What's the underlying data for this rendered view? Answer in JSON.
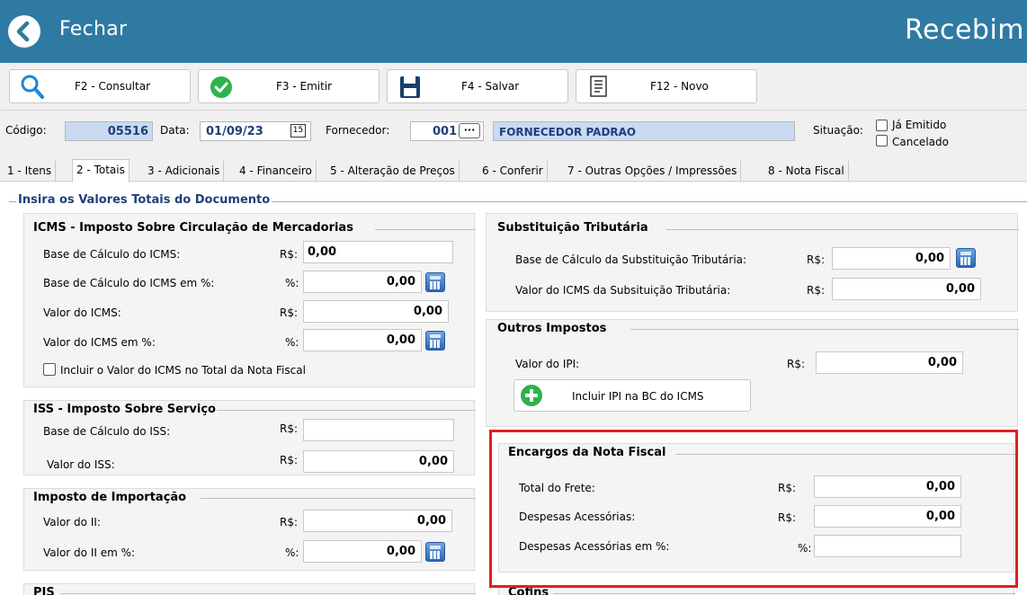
{
  "topbar": {
    "close_label": "Fechar",
    "title": "Recebim"
  },
  "toolbar": {
    "consultar": "F2 - Consultar",
    "emitir": "F3 - Emitir",
    "salvar": "F4 - Salvar",
    "novo": "F12 - Novo"
  },
  "header": {
    "codigo_label": "Código:",
    "codigo_value": "05516",
    "data_label": "Data:",
    "data_value": "01/09/23",
    "calendar_glyph": "15",
    "fornecedor_label": "Fornecedor:",
    "fornecedor_code": "001",
    "fornecedor_lookup": "···",
    "fornecedor_name": "FORNECEDOR PADRAO",
    "situacao_label": "Situação:",
    "ja_emitido": "Já Emitido",
    "cancelado": "Cancelado"
  },
  "tabs": [
    "1 - Itens",
    "2 - Totais",
    "3 - Adicionais",
    "4 - Financeiro",
    "5 - Alteração de Preços",
    "6 - Conferir",
    "7 - Outras Opções / Impressões",
    "8 - Nota Fiscal"
  ],
  "main_legend": "Insira os Valores Totais do Documento",
  "icms": {
    "title": "ICMS - Imposto Sobre Circulação de Mercadorias",
    "rows": [
      {
        "label": "Base de Cálculo do ICMS:",
        "unit": "R$:",
        "value": "0,00"
      },
      {
        "label": "Base de Cálculo do ICMS em %:",
        "unit": "%:",
        "value": "0,00"
      },
      {
        "label": "Valor do ICMS:",
        "unit": "R$:",
        "value": "0,00"
      },
      {
        "label": "Valor do ICMS em %:",
        "unit": "%:",
        "value": "0,00"
      }
    ],
    "checkbox": "Incluir o Valor do ICMS no Total da Nota Fiscal"
  },
  "iss": {
    "title": "ISS - Imposto Sobre Serviço",
    "rows": [
      {
        "label": "Base de Cálculo do ISS:",
        "unit": "R$:",
        "value": ""
      },
      {
        "label": "Valor do ISS:",
        "unit": "R$:",
        "value": "0,00"
      }
    ]
  },
  "importacao": {
    "title": "Imposto de Importação",
    "rows": [
      {
        "label": "Valor do II:",
        "unit": "R$:",
        "value": "0,00"
      },
      {
        "label": "Valor do II em %:",
        "unit": "%:",
        "value": "0,00"
      }
    ]
  },
  "pis": {
    "title": "PIS"
  },
  "st": {
    "title": "Substituição Tributária",
    "rows": [
      {
        "label": "Base de Cálculo da Substituição Tributária:",
        "unit": "R$:",
        "value": "0,00"
      },
      {
        "label": "Valor do ICMS da Subsituição Tributária:",
        "unit": "R$:",
        "value": "0,00"
      }
    ]
  },
  "outros": {
    "title": "Outros Impostos",
    "ipi_label": "Valor do IPI:",
    "ipi_unit": "R$:",
    "ipi_value": "0,00",
    "ipi_button": "Incluir IPI na BC do ICMS"
  },
  "encargos": {
    "title": "Encargos da Nota Fiscal",
    "rows": [
      {
        "label": "Total do Frete:",
        "unit": "R$:",
        "value": "0,00"
      },
      {
        "label": "Despesas Acessórias:",
        "unit": "R$:",
        "value": "0,00"
      },
      {
        "label": "Despesas Acessórias em %:",
        "unit": "%:",
        "value": ""
      }
    ]
  },
  "cofins": {
    "title": "Cofins"
  },
  "colors": {
    "topbar": "#2f7aa3",
    "highlight": "#e02020",
    "legend": "#1f3f7a"
  }
}
